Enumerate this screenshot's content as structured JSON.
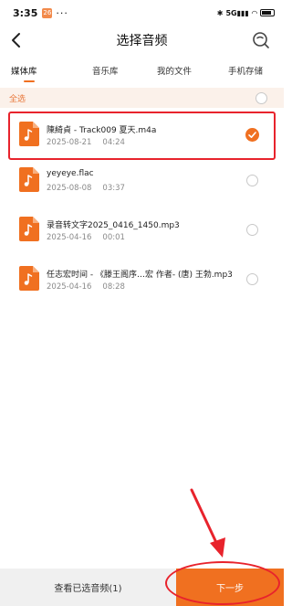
{
  "status_bar": {
    "time": "3:35",
    "app_badge": "26",
    "dots": "···",
    "signal": "5G",
    "battery": "81"
  },
  "header": {
    "title": "选择音频"
  },
  "tabs": [
    {
      "label": "媒体库"
    },
    {
      "label": "音乐库"
    },
    {
      "label": "我的文件"
    },
    {
      "label": "手机存储"
    }
  ],
  "select_all": {
    "label": "全选"
  },
  "files": [
    {
      "name": "陳綺貞 - Track009 夏天.m4a",
      "date": "2025-08-21",
      "duration": "04:24",
      "selected": true
    },
    {
      "name": "yeyeye.flac",
      "date": "2025-08-08",
      "duration": "03:37",
      "selected": false
    },
    {
      "name": "录音转文字2025_0416_1450.mp3",
      "date": "2025-04-16",
      "duration": "00:01",
      "selected": false
    },
    {
      "name": "任志宏时间 - 《滕王阁序…宏 作者- (唐) 王勃.mp3",
      "date": "2025-04-16",
      "duration": "08:28",
      "selected": false
    }
  ],
  "bottom": {
    "view_selected": "查看已选音频(1)",
    "next": "下一步"
  },
  "colors": {
    "accent": "#f07020",
    "annotation": "#e8232c",
    "select_all_bg": "#fbf1ea"
  }
}
